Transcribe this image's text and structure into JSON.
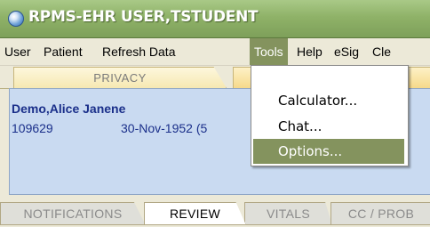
{
  "window": {
    "title": "RPMS-EHR USER,TSTUDENT"
  },
  "menubar": {
    "items": [
      "User",
      "Patient",
      "Refresh Data",
      "Tools",
      "Help",
      "eSig",
      "Cle"
    ]
  },
  "top_tabs": {
    "privacy": "PRIVACY"
  },
  "patient": {
    "name": "Demo,Alice Janene",
    "id": "109629",
    "dob": "30-Nov-1952 (5"
  },
  "bottom_tabs": [
    "NOTIFICATIONS",
    "REVIEW",
    "VITALS",
    "CC / PROB"
  ],
  "tools_menu": {
    "items": [
      "Calculator...",
      "Chat...",
      "Options..."
    ],
    "highlighted": "Options..."
  },
  "colors": {
    "titlebar": "#8fb268",
    "menu_highlight": "#84935e",
    "patient_panel": "#c9daf1",
    "patient_text": "#1a2f8a"
  }
}
